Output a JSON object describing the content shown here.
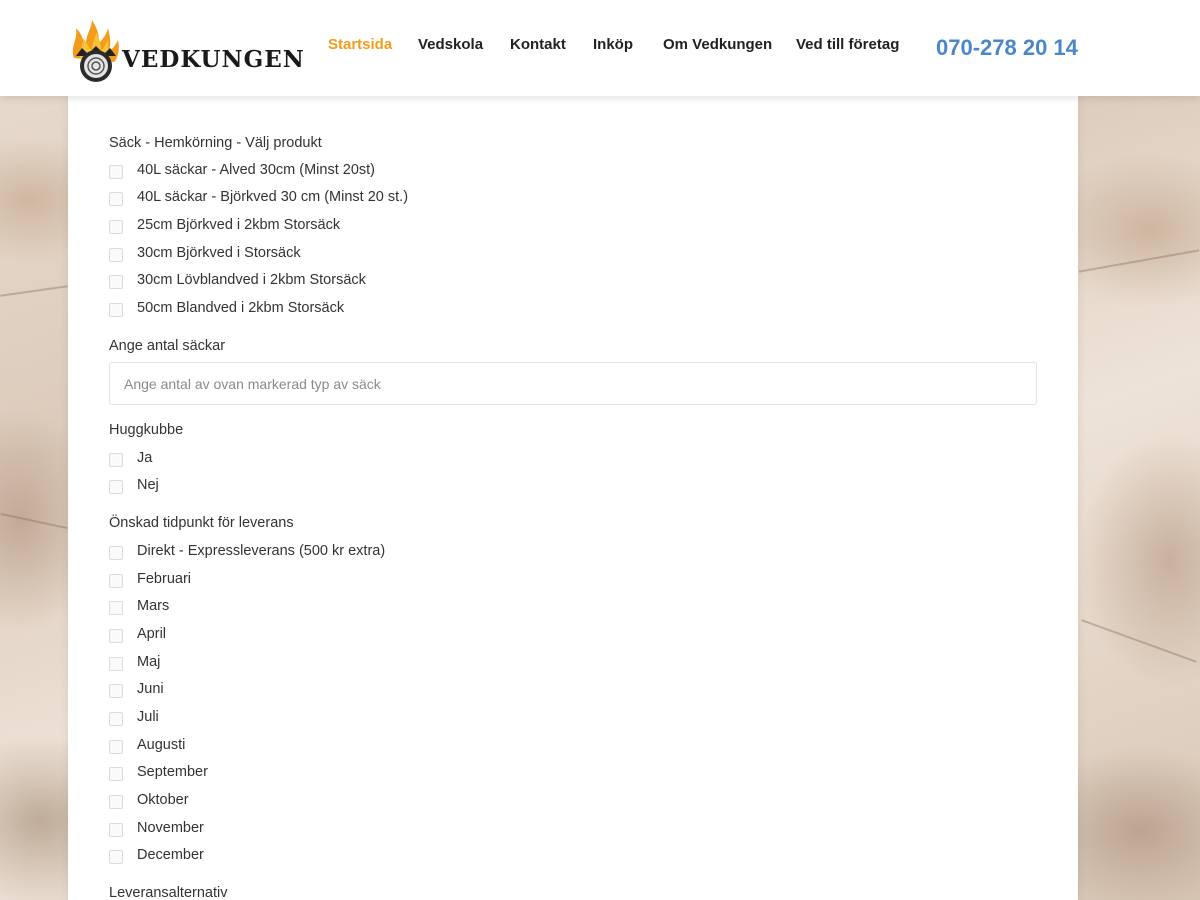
{
  "brand": {
    "name": "VEDKUNGEN"
  },
  "nav": {
    "items": [
      {
        "label": "Startsida",
        "active": true
      },
      {
        "label": "Vedskola"
      },
      {
        "label": "Kontakt"
      },
      {
        "label": "Inköp"
      },
      {
        "label": "Om Vedkungen"
      },
      {
        "label": "Ved till företag"
      }
    ],
    "phone": "070-278 20 14",
    "active_color": "#f39c1a",
    "phone_color": "#4a86c8"
  },
  "form": {
    "product": {
      "label": "Säck - Hemkörning - Välj produkt",
      "options": [
        "40L säckar - Alved 30cm (Minst 20st)",
        "40L säckar - Björkved 30 cm (Minst 20 st.)",
        "25cm Björkved i 2kbm Storsäck",
        "30cm Björkved i Storsäck",
        "30cm Lövblandved i 2kbm Storsäck",
        "50cm Blandved i 2kbm Storsäck"
      ]
    },
    "quantity": {
      "label": "Ange antal säckar",
      "placeholder": "Ange antal av ovan markerad typ av säck",
      "value": ""
    },
    "huggkubbe": {
      "label": "Huggkubbe",
      "options": [
        "Ja",
        "Nej"
      ]
    },
    "delivery_time": {
      "label": "Önskad tidpunkt för leverans",
      "options": [
        "Direkt - Expressleverans (500 kr extra)",
        "Februari",
        "Mars",
        "April",
        "Maj",
        "Juni",
        "Juli",
        "Augusti",
        "September",
        "Oktober",
        "November",
        "December"
      ]
    },
    "delivery_options": {
      "label": "Leveransalternativ"
    }
  }
}
